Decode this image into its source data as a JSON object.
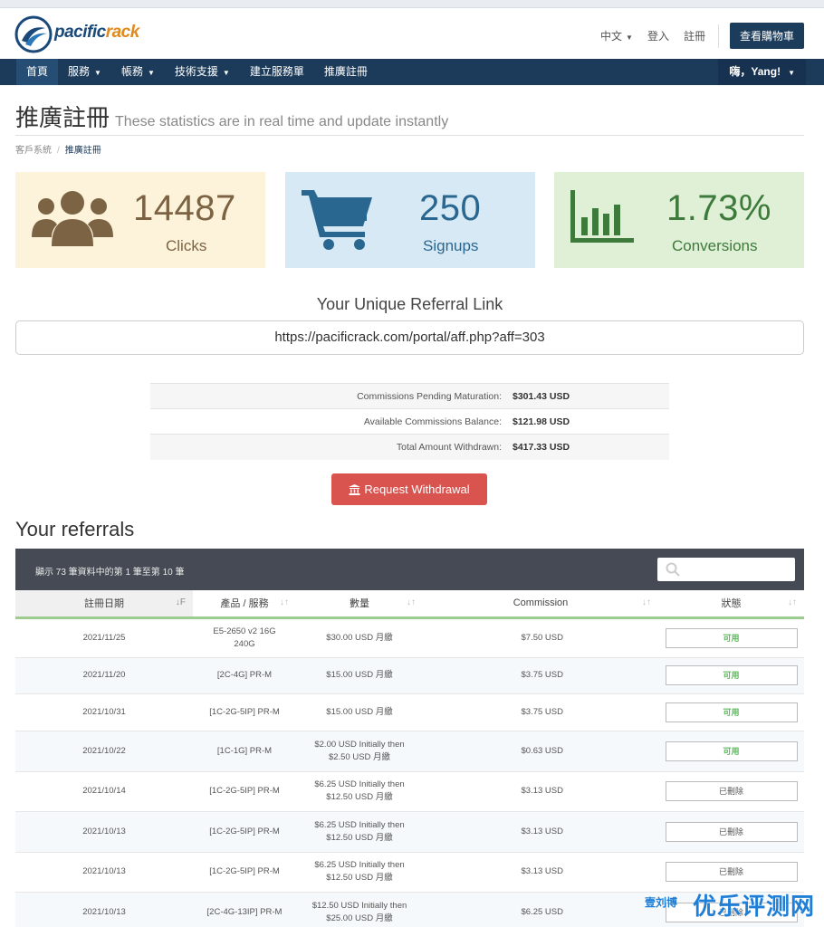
{
  "header": {
    "logo_a": "pacific",
    "logo_b": "rack",
    "lang": "中文",
    "login": "登入",
    "register": "註冊",
    "cart": "查看購物車"
  },
  "nav": {
    "items": [
      {
        "label": "首頁"
      },
      {
        "label": "服務"
      },
      {
        "label": "帳務"
      },
      {
        "label": "技術支援"
      },
      {
        "label": "建立服務單"
      },
      {
        "label": "推廣註冊"
      }
    ],
    "user": "嗨，Yang!"
  },
  "page": {
    "title": "推廣註冊",
    "subtitle": "These statistics are in real time and update instantly",
    "breadcrumb_home": "客戶系統",
    "breadcrumb_current": "推廣註冊"
  },
  "stats": [
    {
      "value": "14487",
      "label": "Clicks",
      "icon": "users-icon"
    },
    {
      "value": "250",
      "label": "Signups",
      "icon": "shopping-cart-icon"
    },
    {
      "value": "1.73%",
      "label": "Conversions",
      "icon": "bar-chart-icon"
    }
  ],
  "referral": {
    "title": "Your Unique Referral Link",
    "link": "https://pacificrack.com/portal/aff.php?aff=303"
  },
  "commissions": [
    {
      "label": "Commissions Pending Maturation:",
      "value": "$301.43 USD"
    },
    {
      "label": "Available Commissions Balance:",
      "value": "$121.98 USD"
    },
    {
      "label": "Total Amount Withdrawn:",
      "value": "$417.33 USD"
    }
  ],
  "withdraw_label": "Request Withdrawal",
  "referrals": {
    "title": "Your referrals",
    "info": "顯示 73 筆資料中的第 1 筆至第 10 筆",
    "columns": [
      "註冊日期",
      "產品 / 服務",
      "數量",
      "Commission",
      "狀態"
    ],
    "rows": [
      {
        "date": "2021/11/25",
        "product": "E5-2650 v2 16G 240G",
        "amount": "$30.00 USD 月繳",
        "commission": "$7.50 USD",
        "status": "可用",
        "state": "ok"
      },
      {
        "date": "2021/11/20",
        "product": "[2C-4G] PR-M",
        "amount": "$15.00 USD 月繳",
        "commission": "$3.75 USD",
        "status": "可用",
        "state": "ok"
      },
      {
        "date": "2021/10/31",
        "product": "[1C-2G-5IP] PR-M",
        "amount": "$15.00 USD 月繳",
        "commission": "$3.75 USD",
        "status": "可用",
        "state": "ok"
      },
      {
        "date": "2021/10/22",
        "product": "[1C-1G] PR-M",
        "amount": "$2.00 USD Initially then $2.50 USD 月繳",
        "commission": "$0.63 USD",
        "status": "可用",
        "state": "ok"
      },
      {
        "date": "2021/10/14",
        "product": "[1C-2G-5IP] PR-M",
        "amount": "$6.25 USD Initially then $12.50 USD 月繳",
        "commission": "$3.13 USD",
        "status": "已刪除",
        "state": "del"
      },
      {
        "date": "2021/10/13",
        "product": "[1C-2G-5IP] PR-M",
        "amount": "$6.25 USD Initially then $12.50 USD 月繳",
        "commission": "$3.13 USD",
        "status": "已刪除",
        "state": "del"
      },
      {
        "date": "2021/10/13",
        "product": "[1C-2G-5IP] PR-M",
        "amount": "$6.25 USD Initially then $12.50 USD 月繳",
        "commission": "$3.13 USD",
        "status": "已刪除",
        "state": "del"
      },
      {
        "date": "2021/10/13",
        "product": "[2C-4G-13IP] PR-M",
        "amount": "$12.50 USD Initially then $25.00 USD 月繳",
        "commission": "$6.25 USD",
        "status": "已刪除",
        "state": "del"
      }
    ]
  },
  "watermark": "优乐评测网",
  "watermark_small": "壹刘博"
}
